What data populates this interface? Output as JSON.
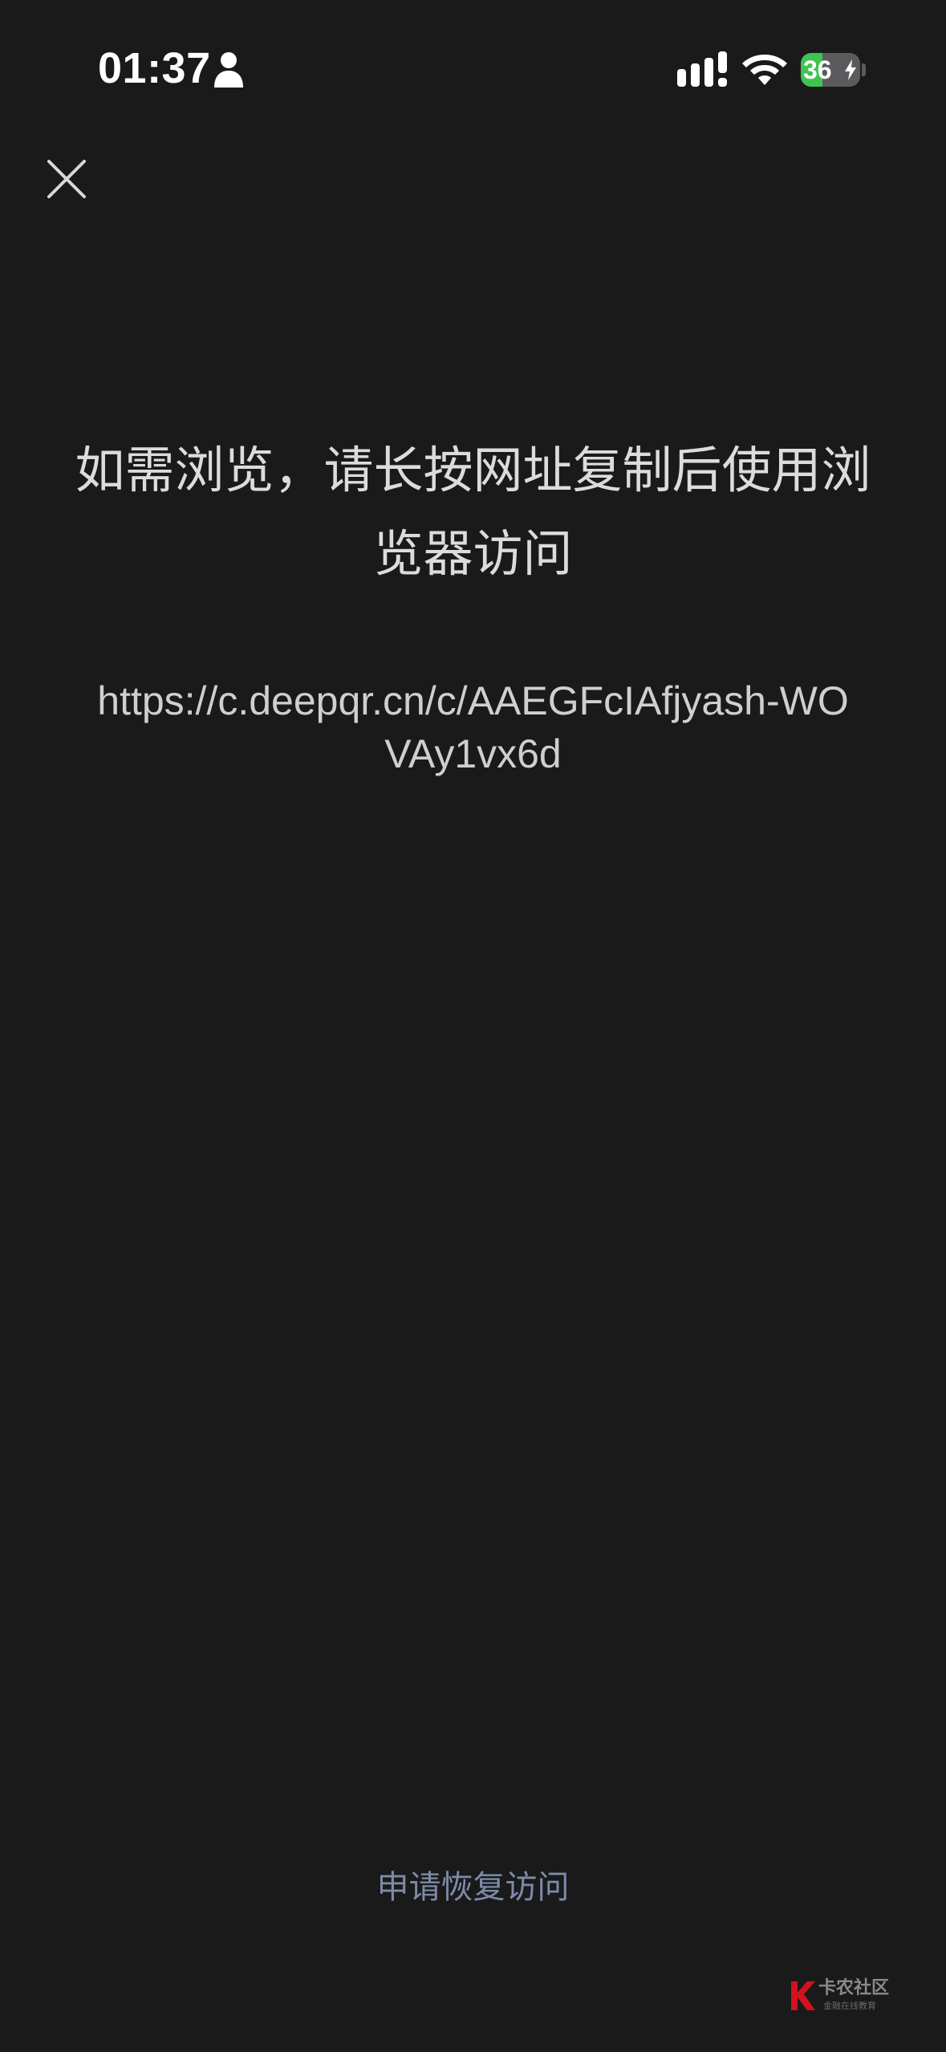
{
  "status_bar": {
    "time": "01:37",
    "battery_level": "36",
    "battery_fraction": 0.36,
    "icons": [
      "person-icon",
      "signal-icon",
      "wifi-icon",
      "battery-icon",
      "bolt-icon"
    ]
  },
  "header": {
    "close_icon": "close-icon"
  },
  "main": {
    "message": "如需浏览，请长按网址复制后使用浏览器访问",
    "url": "https://c.deepqr.cn/c/AAEGFcIAfjyash-WOVAy1vx6d"
  },
  "footer": {
    "restore_label": "申请恢复访问"
  },
  "watermark": {
    "title": "卡农社区",
    "subtitle": "金融在线教育"
  },
  "colors": {
    "background": "#1a1a1b",
    "text": "#dcdcdc",
    "link": "#7d8ba8",
    "battery_fill": "#3fc451"
  }
}
